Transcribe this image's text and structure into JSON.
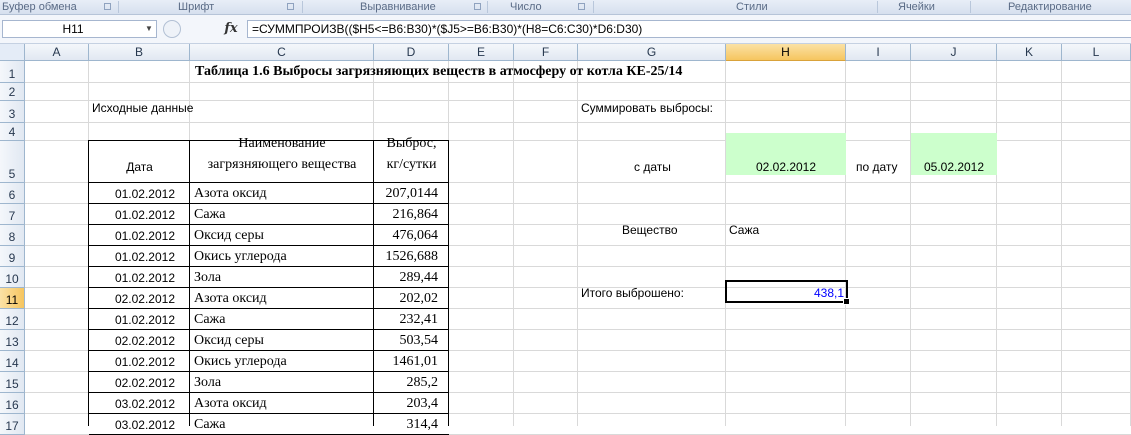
{
  "ribbon": {
    "groups": [
      "Буфер обмена",
      "Шрифт",
      "Выравнивание",
      "Число",
      "Стили",
      "Ячейки",
      "Редактирование"
    ]
  },
  "formula_bar": {
    "name_box": "H11",
    "fx_label": "fx",
    "formula": "=СУММПРОИЗВ(($H5<=B6:B30)*($J5>=B6:B30)*(H8=C6:C30)*D6:D30)"
  },
  "grid": {
    "active_cell": "H11",
    "columns": [
      "A",
      "B",
      "C",
      "D",
      "E",
      "F",
      "G",
      "H",
      "I",
      "J",
      "K",
      "L"
    ],
    "rows": [
      "1",
      "2",
      "3",
      "4",
      "5",
      "6",
      "7",
      "8",
      "9",
      "10",
      "11",
      "12",
      "13",
      "14",
      "15",
      "16",
      "17"
    ]
  },
  "sheet": {
    "title": "Таблица 1.6 Выбросы загрязняющих веществ в атмосферу от котла КЕ-25/14",
    "source_label": "Исходные данные",
    "header": {
      "date": "Дата",
      "name_line1": "Наименование",
      "name_line2": "загрязняющего вещества",
      "emission_line1": "Выброс,",
      "emission_line2": "кг/сутки"
    },
    "data_rows": [
      {
        "date": "01.02.2012",
        "substance": "Азота оксид",
        "emission": "207,0144"
      },
      {
        "date": "01.02.2012",
        "substance": "Сажа",
        "emission": "216,864"
      },
      {
        "date": "01.02.2012",
        "substance": "Оксид серы",
        "emission": "476,064"
      },
      {
        "date": "01.02.2012",
        "substance": "Окись углерода",
        "emission": "1526,688"
      },
      {
        "date": "01.02.2012",
        "substance": "Зола",
        "emission": "289,44"
      },
      {
        "date": "02.02.2012",
        "substance": "Азота оксид",
        "emission": "202,02"
      },
      {
        "date": "01.02.2012",
        "substance": "Сажа",
        "emission": "232,41"
      },
      {
        "date": "02.02.2012",
        "substance": "Оксид серы",
        "emission": "503,54"
      },
      {
        "date": "01.02.2012",
        "substance": "Окись углерода",
        "emission": "1461,01"
      },
      {
        "date": "02.02.2012",
        "substance": "Зола",
        "emission": "285,2"
      },
      {
        "date": "03.02.2012",
        "substance": "Азота оксид",
        "emission": "203,4"
      },
      {
        "date": "03.02.2012",
        "substance": "Сажа",
        "emission": "314,4"
      }
    ],
    "summary": {
      "label": "Суммировать выбросы:",
      "from_label": "с даты",
      "from_value": "02.02.2012",
      "to_label": "по дату",
      "to_value": "05.02.2012",
      "substance_label": "Вещество",
      "substance_value": "Сажа",
      "total_label": "Итого выброшено:",
      "total_value": "438,1"
    }
  },
  "colors": {
    "input_fill": "#ccffcc",
    "result_text": "#0000ff",
    "selected_header": "#f6c55f"
  }
}
